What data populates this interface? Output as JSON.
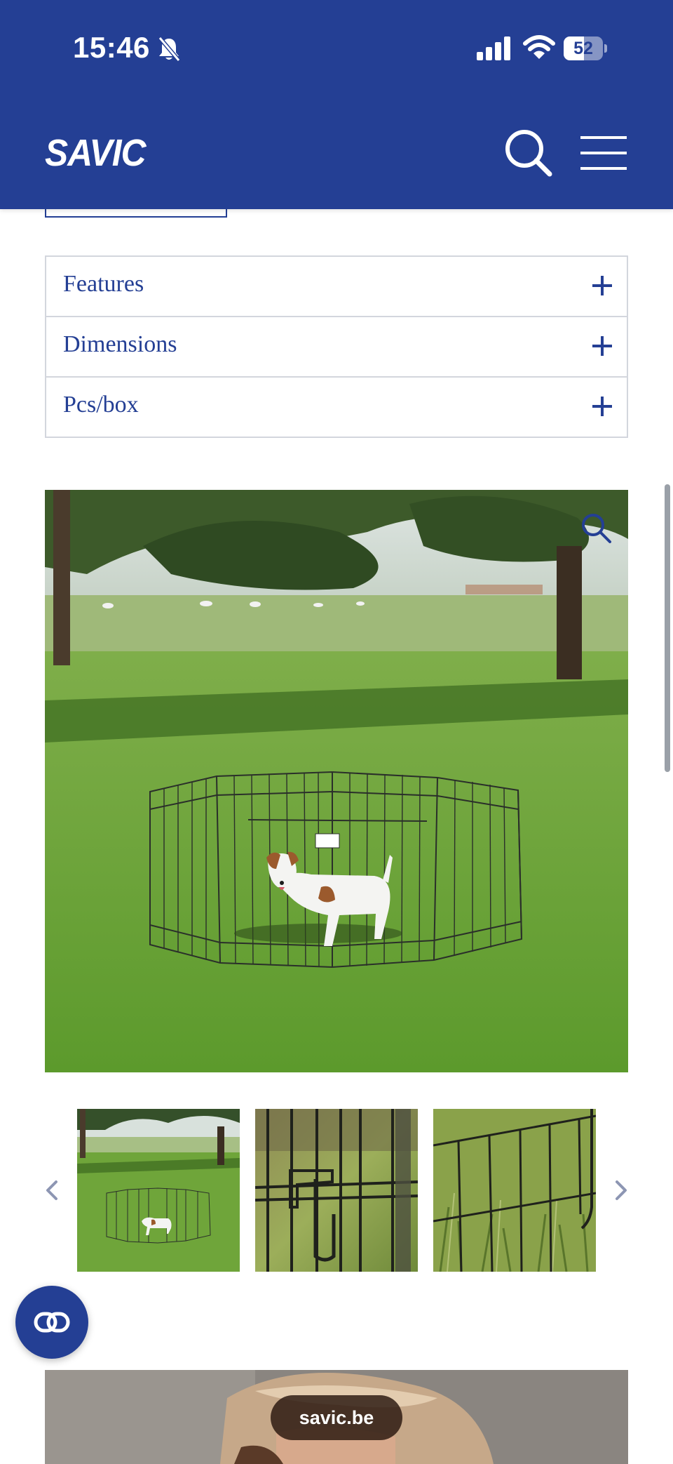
{
  "status_bar": {
    "time": "15:46",
    "battery": "52",
    "battery_level": 0.52,
    "icons": [
      "bell-slash-icon",
      "cellular-signal-icon",
      "wifi-icon",
      "battery-icon"
    ]
  },
  "site_header": {
    "logo": "SAVIC",
    "icons": [
      "search-icon",
      "hamburger-menu-icon"
    ],
    "background_color": "#243f94"
  },
  "accordion": {
    "items": [
      {
        "label": "Features",
        "icon": "plus-icon"
      },
      {
        "label": "Dimensions",
        "icon": "plus-icon"
      },
      {
        "label": "Pcs/box",
        "icon": "plus-icon"
      }
    ]
  },
  "gallery": {
    "main_image": "dog-in-playpen-on-grass-photo",
    "zoom_icon": "magnifier-icon",
    "thumbnails": [
      {
        "name": "playpen-overview-thumbnail"
      },
      {
        "name": "playpen-latch-closeup-thumbnail"
      },
      {
        "name": "playpen-panel-grass-closeup-thumbnail"
      }
    ],
    "prev_icon": "chevron-left-icon",
    "next_icon": "chevron-right-icon"
  },
  "fab": {
    "icon": "link-icon"
  },
  "browser": {
    "url": "savic.be"
  },
  "colors": {
    "brand_blue": "#243f94",
    "border_gray": "#d3d6dd"
  }
}
